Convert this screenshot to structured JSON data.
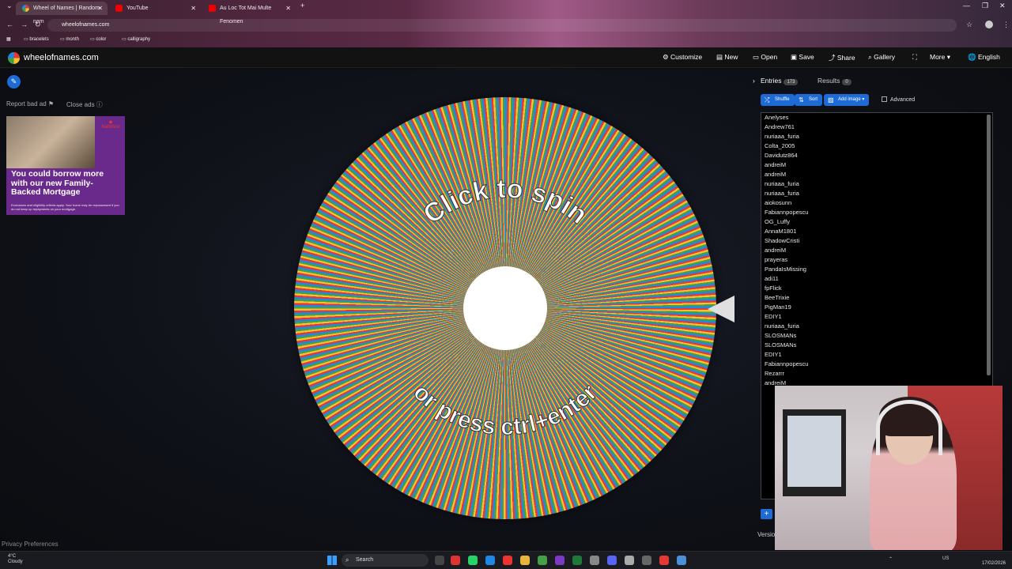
{
  "browser": {
    "tabs": [
      {
        "title": "Wheel of Names | Random nam",
        "active": true
      },
      {
        "title": "YouTube",
        "active": false
      },
      {
        "title": "Au Loc Tot Mai Multe Fenomen",
        "active": false
      }
    ],
    "url": "wheelofnames.com",
    "bookmarks": [
      "bracelets",
      "month",
      "color",
      "calligraphy"
    ]
  },
  "app": {
    "name": "wheelofnames.com",
    "menu": [
      "Customize",
      "New",
      "Open",
      "Save",
      "Share",
      "Gallery",
      "More",
      "English"
    ]
  },
  "ad": {
    "report": "Report bad ad",
    "close": "Close ads",
    "headline": "You could borrow more with our new Family-Backed Mortgage",
    "brand": "NatWest",
    "fineprint": "Exclusions and eligibility criteria apply. Your home may be repossessed if you do not keep up repayments on your mortgage."
  },
  "wheel": {
    "top_text": "Click to spin",
    "bottom_text": "or press ctrl+enter"
  },
  "panel": {
    "tab_entries": "Entries",
    "entries_count": "173",
    "tab_results": "Results",
    "results_count": "0",
    "btn_shuffle": "Shuffle",
    "btn_sort": "Sort",
    "btn_add_image": "Add image",
    "advanced": "Advanced",
    "entries": [
      "Anelyses",
      "Andrew761",
      "nuriaaa_furia",
      "Colta_2005",
      "Davidutz864",
      "andreiM",
      "andreiM",
      "nuriaaa_furia",
      "nuriaaa_furia",
      "aiokosunn",
      "Fabiannpopescu",
      "OG_Luffy",
      "AnnaM1801",
      "ShadowCristi",
      "andreiM",
      "prayeras",
      "PandaIsMissing",
      "adi11",
      "fpFlick",
      "BeeTrixie",
      "PigMan19",
      "EDIY1",
      "nuriaaa_furia",
      "SLOSMANs",
      "SLOSMANs",
      "EDIY1",
      "Fabiannpopescu",
      "Rezarrr",
      "andreiM"
    ],
    "version": "Versio"
  },
  "footer": {
    "privacy": "Privacy Preferences"
  },
  "taskbar": {
    "weather_temp": "4°C",
    "weather_desc": "Cloudy",
    "search": "Search",
    "lang": "US",
    "date": "17/02/2026"
  }
}
